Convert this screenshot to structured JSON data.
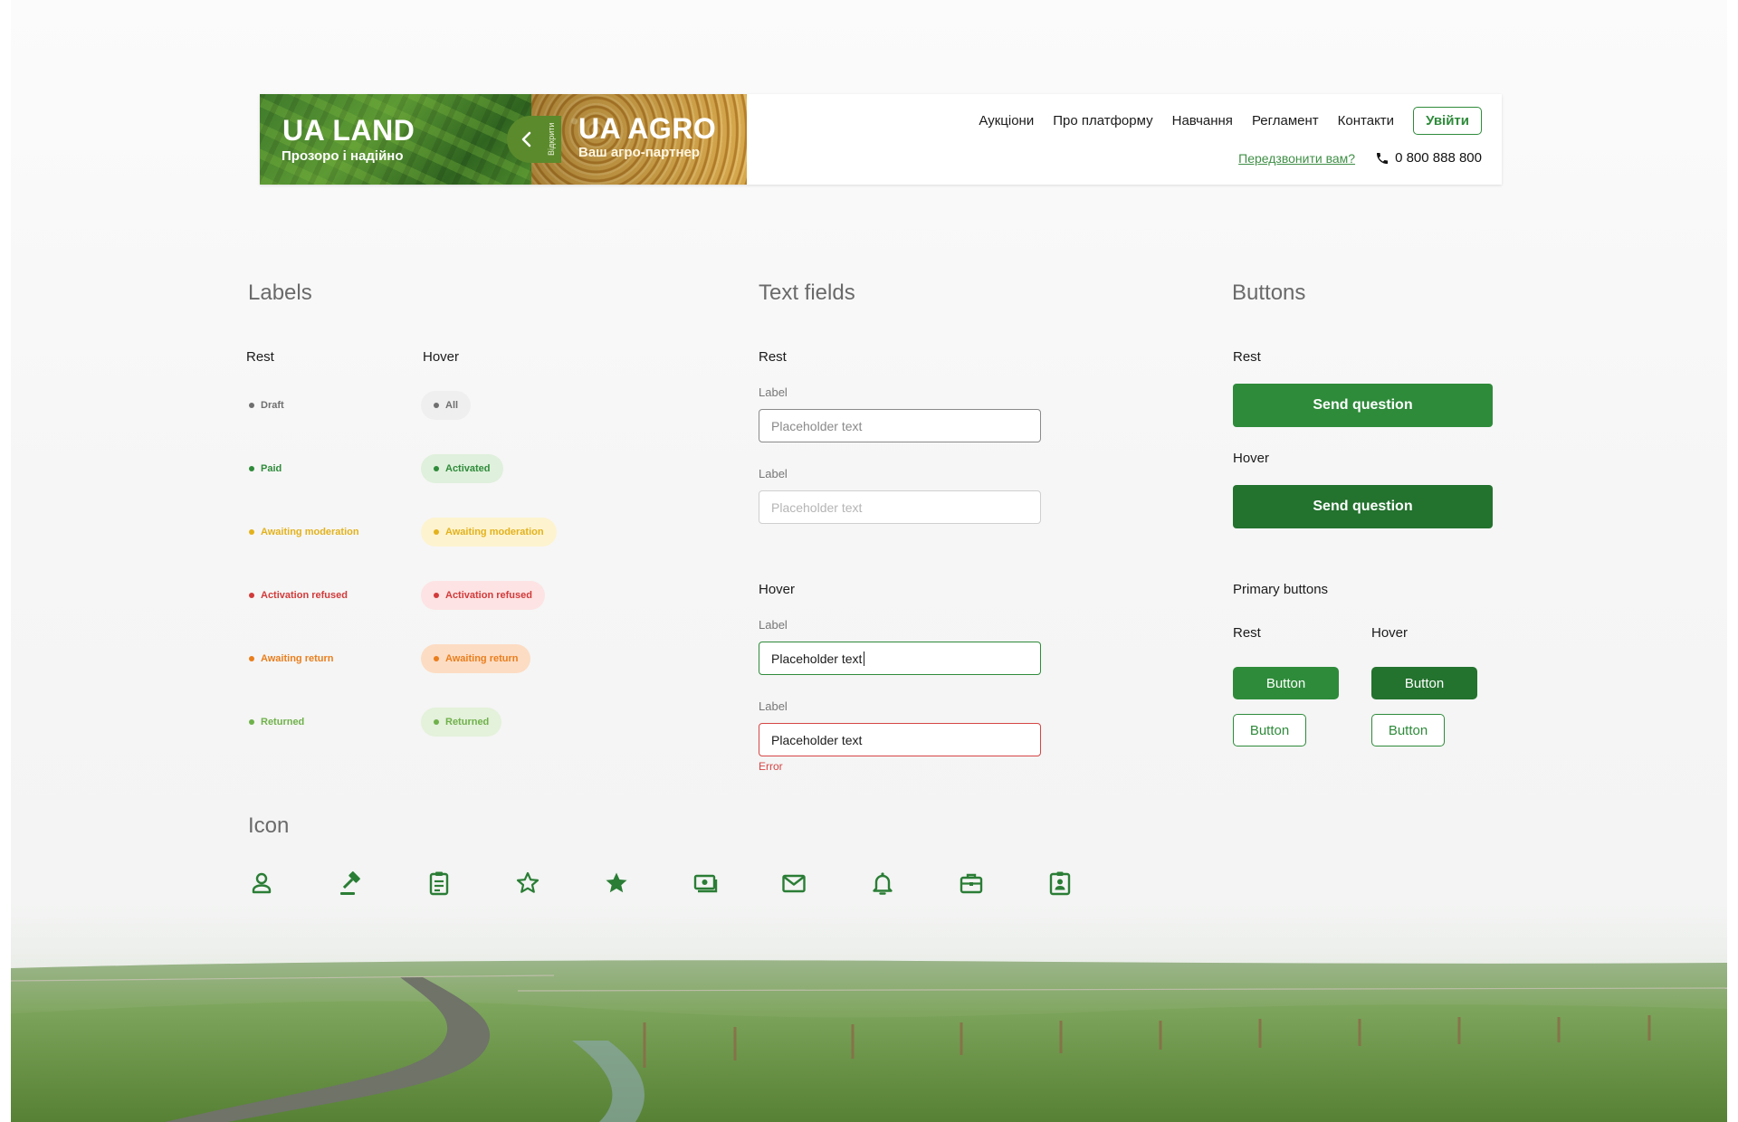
{
  "colors": {
    "brand_green": "#2e8b3a",
    "brand_green_dark": "#23722e",
    "icon_green": "#2a7d35",
    "draft": "#6f6f6f",
    "paid": "#2e8b3a",
    "awaiting_moderation": "#e3b21c",
    "activation_refused": "#d23a3a",
    "awaiting_return": "#ea7e1c",
    "returned": "#6fb14a",
    "error": "#d64545"
  },
  "header": {
    "banner_left": {
      "title": "UA LAND",
      "subtitle": "Прозоро і надійно"
    },
    "banner_right": {
      "title": "UA AGRO",
      "subtitle": "Ваш агро-партнер"
    },
    "banner_toggle_label": "Відкрити",
    "nav": [
      "Аукціони",
      "Про платформу",
      "Навчання",
      "Регламент",
      "Контакти"
    ],
    "login_label": "Увійти",
    "callback_label": "Передзвонити вам?",
    "phone": "0 800 888 800"
  },
  "labels": {
    "title": "Labels",
    "rest_title": "Rest",
    "hover_title": "Hover",
    "rest": [
      "Draft",
      "Paid",
      "Awaiting moderation",
      "Activation refused",
      "Awaiting return",
      "Returned"
    ],
    "hover": [
      "All",
      "Activated",
      "Awaiting moderation",
      "Activation refused",
      "Awaiting return",
      "Returned"
    ]
  },
  "text_fields": {
    "title": "Text fields",
    "rest_title": "Rest",
    "hover_title": "Hover",
    "fields": [
      {
        "label": "Label",
        "value": "Placeholder text"
      },
      {
        "label": "Label",
        "value": "Placeholder text"
      },
      {
        "label": "Label",
        "value": "Placeholder text"
      },
      {
        "label": "Label",
        "value": "Placeholder text"
      }
    ],
    "error_text": "Error"
  },
  "buttons": {
    "title": "Buttons",
    "rest_title": "Rest",
    "hover_title": "Hover",
    "send_rest": "Send question",
    "send_hover": "Send question",
    "primary_title": "Primary buttons",
    "primary_rest_title": "Rest",
    "primary_hover_title": "Hover",
    "button_label": "Button"
  },
  "icons": {
    "title": "Icon",
    "items": [
      "user-icon",
      "gavel-icon",
      "clipboard-icon",
      "star-outline-icon",
      "star-filled-icon",
      "money-icon",
      "mail-icon",
      "bell-icon",
      "briefcase-icon",
      "id-badge-icon"
    ]
  }
}
